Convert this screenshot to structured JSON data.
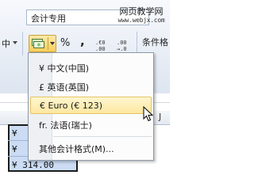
{
  "ribbon": {
    "partial_left_label": "中",
    "number_format_value": "会计专用",
    "accounting_button_icon": "currency-notes-icon",
    "percent_label": "%",
    "comma_label": ",",
    "increase_decimal_label": ".€0\n.00",
    "decrease_decimal_label": ".00\n→.0",
    "conditional_format_label": "条件格"
  },
  "watermark": {
    "name": "网页教学网",
    "url": "www.webjx.com"
  },
  "currency_menu": {
    "items": [
      {
        "label": "¥ 中文(中国)"
      },
      {
        "label": "£ 英语(英国)"
      },
      {
        "label": "€ Euro (€ 123)"
      },
      {
        "label": "fr. 法语(瑞士)"
      },
      {
        "label": "其他会计格式(M)..."
      }
    ],
    "highlighted_index": 2
  },
  "sheet": {
    "column_header_partial": "J",
    "cells": [
      "¥",
      "¥",
      "¥ 314.00"
    ]
  },
  "colors": {
    "accent_button": "#f8cf5c",
    "selection_fill": "#cbdcf4",
    "menu_highlight": "#fde7a0"
  }
}
